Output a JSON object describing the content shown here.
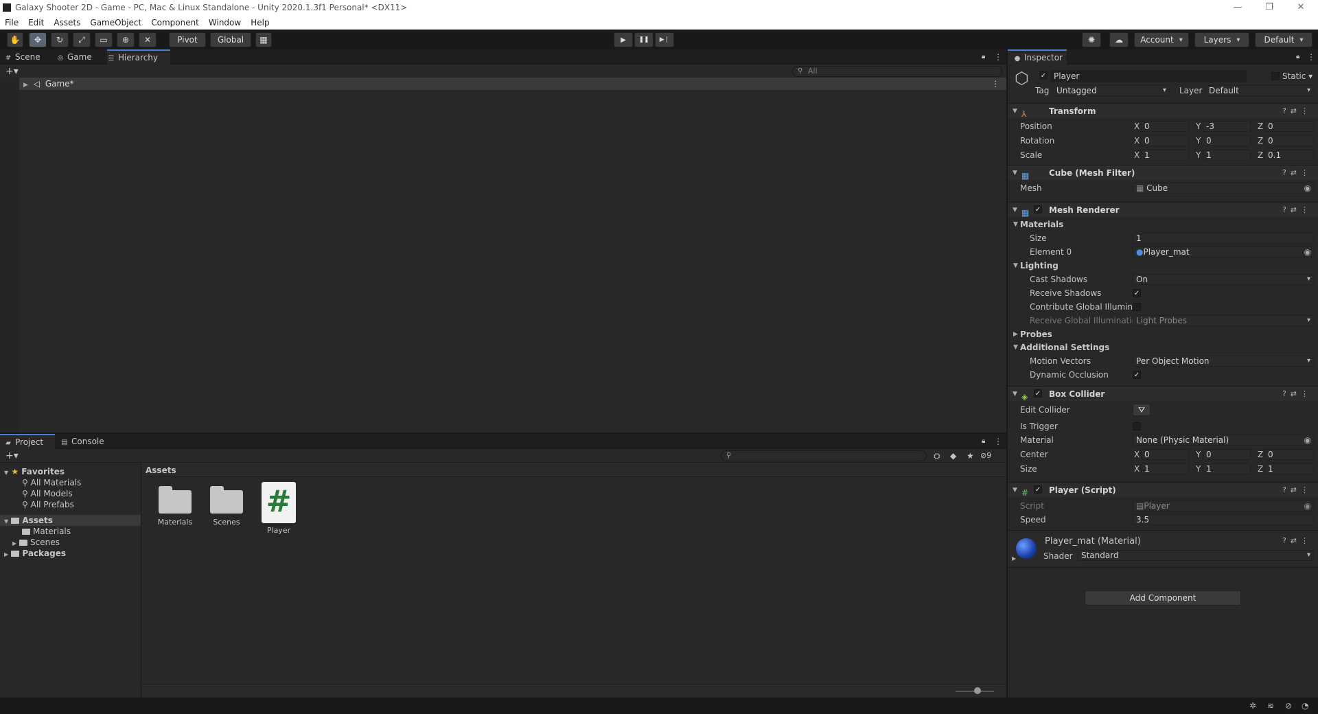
{
  "window": {
    "title": "Galaxy Shooter 2D - Game - PC, Mac & Linux Standalone - Unity 2020.1.3f1 Personal* <DX11>",
    "controls": [
      "—",
      "❐",
      "✕"
    ]
  },
  "menu": [
    "File",
    "Edit",
    "Assets",
    "GameObject",
    "Component",
    "Window",
    "Help"
  ],
  "toolbar": {
    "tools": [
      "hand-tool",
      "move-tool",
      "rotate-tool",
      "scale-tool",
      "rect-tool",
      "transform-tool",
      "custom-tool"
    ],
    "pivot": "Pivot",
    "global": "Global",
    "play": "▶",
    "pause": "❚❚",
    "step": "▶❘",
    "account": "Account",
    "layers": "Layers",
    "layout": "Default"
  },
  "scene_panel": {
    "tabs": [
      "Scene",
      "Game",
      "Hierarchy"
    ],
    "selected_tab": "Hierarchy",
    "search_placeholder": "All",
    "hierarchy": {
      "root": "Game*"
    }
  },
  "project_panel": {
    "tabs": [
      "Project",
      "Console"
    ],
    "hidden_count": "9",
    "favorites": {
      "label": "Favorites",
      "items": [
        "All Materials",
        "All Models",
        "All Prefabs"
      ]
    },
    "assets_tree": {
      "label": "Assets",
      "children": [
        "Materials",
        "Scenes"
      ]
    },
    "packages": "Packages",
    "breadcrumb": "Assets",
    "assets": [
      {
        "name": "Materials",
        "type": "folder"
      },
      {
        "name": "Scenes",
        "type": "folder"
      },
      {
        "name": "Player",
        "type": "script",
        "glyph": "#"
      }
    ]
  },
  "inspector": {
    "tab": "Inspector",
    "object_name": "Player",
    "static_label": "Static",
    "tag_label": "Tag",
    "tag_value": "Untagged",
    "layer_label": "Layer",
    "layer_value": "Default",
    "transform": {
      "title": "Transform",
      "position": {
        "label": "Position",
        "x": "0",
        "y": "-3",
        "z": "0"
      },
      "rotation": {
        "label": "Rotation",
        "x": "0",
        "y": "0",
        "z": "0"
      },
      "scale": {
        "label": "Scale",
        "x": "1",
        "y": "1",
        "z": "0.1"
      }
    },
    "mesh_filter": {
      "title": "Cube (Mesh Filter)",
      "mesh_label": "Mesh",
      "mesh_value": "Cube"
    },
    "mesh_renderer": {
      "title": "Mesh Renderer",
      "materials": "Materials",
      "size_label": "Size",
      "size_value": "1",
      "element0_label": "Element 0",
      "element0_value": "Player_mat",
      "lighting": "Lighting",
      "cast_shadows_label": "Cast Shadows",
      "cast_shadows_value": "On",
      "receive_shadows_label": "Receive Shadows",
      "receive_shadows_checked": true,
      "contribute_gi_label": "Contribute Global Illuminat",
      "receive_gi_label": "Receive Global Illuminatior",
      "receive_gi_value": "Light Probes",
      "probes": "Probes",
      "additional": "Additional Settings",
      "motion_vectors_label": "Motion Vectors",
      "motion_vectors_value": "Per Object Motion",
      "dynamic_occlusion_label": "Dynamic Occlusion",
      "dynamic_occlusion_checked": true
    },
    "box_collider": {
      "title": "Box Collider",
      "edit_collider_label": "Edit Collider",
      "is_trigger_label": "Is Trigger",
      "material_label": "Material",
      "material_value": "None (Physic Material)",
      "center": {
        "label": "Center",
        "x": "0",
        "y": "0",
        "z": "0"
      },
      "size": {
        "label": "Size",
        "x": "1",
        "y": "1",
        "z": "1"
      }
    },
    "player_script": {
      "title": "Player (Script)",
      "script_label": "Script",
      "script_value": "Player",
      "speed_label": "Speed",
      "speed_value": "3.5"
    },
    "material": {
      "title": "Player_mat (Material)",
      "shader_label": "Shader",
      "shader_value": "Standard"
    },
    "add_component": "Add Component",
    "axis": {
      "x": "X",
      "y": "Y",
      "z": "Z"
    }
  },
  "colors": {
    "accent": "#4c7fd0",
    "panel": "#282828",
    "header": "#1e1e1e"
  }
}
